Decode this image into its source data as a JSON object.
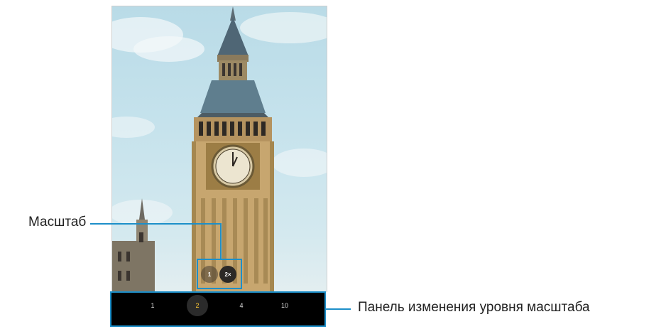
{
  "callouts": {
    "zoom": "Масштаб",
    "zoom_panel": "Панель изменения уровня масштаба"
  },
  "zoom_control": {
    "option_1": "1",
    "option_2": "2×"
  },
  "zoom_bar": {
    "levels": [
      "1",
      "2",
      "4",
      "10"
    ],
    "selected": "2"
  },
  "colors": {
    "accent": "#1d8fc9",
    "selected_level": "#ffc933",
    "bar_background": "#000000"
  },
  "icons": {
    "preview": "camera-viewfinder-image"
  }
}
